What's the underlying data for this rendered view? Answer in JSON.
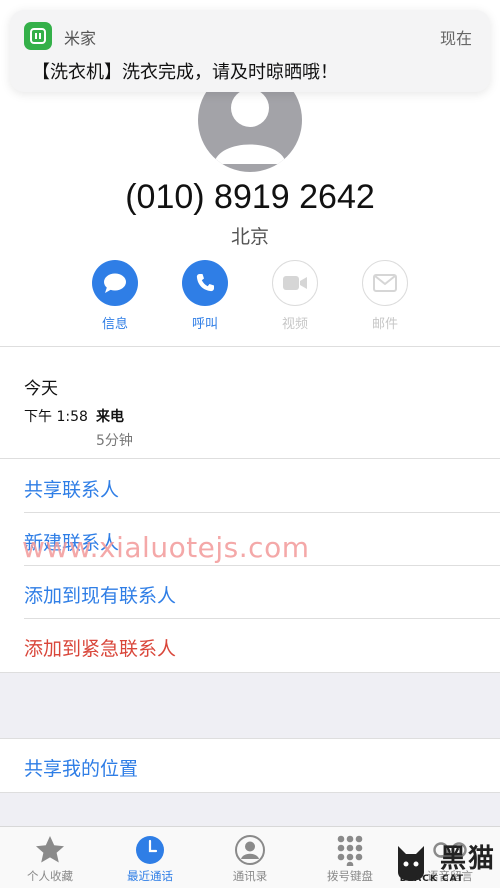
{
  "notification": {
    "app_name": "米家",
    "time": "现在",
    "message": "【洗衣机】洗衣完成，请及时晾晒哦！",
    "app_icon": "mijia-icon",
    "accent": "#34b049"
  },
  "contact": {
    "phone": "(010) 8919 2642",
    "location": "北京"
  },
  "actions": [
    {
      "label": "信息",
      "icon": "message-icon",
      "enabled": true
    },
    {
      "label": "呼叫",
      "icon": "phone-icon",
      "enabled": true
    },
    {
      "label": "视频",
      "icon": "video-icon",
      "enabled": false
    },
    {
      "label": "邮件",
      "icon": "mail-icon",
      "enabled": false
    }
  ],
  "history": {
    "day": "今天",
    "time": "下午 1:58",
    "type": "来电",
    "duration": "5分钟"
  },
  "options": [
    {
      "label": "共享联系人",
      "color": "#2f7ee6"
    },
    {
      "label": "新建联系人",
      "color": "#2f7ee6"
    },
    {
      "label": "添加到现有联系人",
      "color": "#2f7ee6"
    },
    {
      "label": "添加到紧急联系人",
      "color": "#d9463a"
    }
  ],
  "share_location": "共享我的位置",
  "watermark": "www.xialuotejs.com",
  "tabs": [
    {
      "label": "个人收藏",
      "icon": "star-icon",
      "active": false
    },
    {
      "label": "最近通话",
      "icon": "clock-icon",
      "active": true
    },
    {
      "label": "通讯录",
      "icon": "contacts-icon",
      "active": false
    },
    {
      "label": "拨号键盘",
      "icon": "keypad-icon",
      "active": false
    },
    {
      "label": "语音留言",
      "icon": "voicemail-icon",
      "active": false
    }
  ],
  "brand_logo": {
    "big": "黑猫",
    "small": "BLACK CAT"
  },
  "colors": {
    "accent": "#2f7ee6",
    "danger": "#d9463a",
    "background_band": "#efeff4"
  }
}
